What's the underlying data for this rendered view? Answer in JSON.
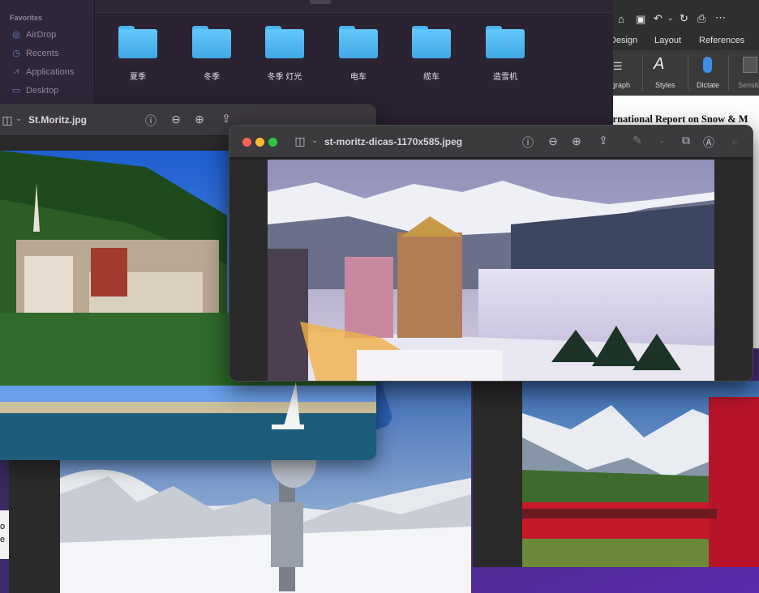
{
  "finder": {
    "favorites_heading": "Favorites",
    "sidebar": [
      {
        "label": "AirDrop",
        "icon": "airdrop-icon"
      },
      {
        "label": "Recents",
        "icon": "clock-icon"
      },
      {
        "label": "Applications",
        "icon": "applications-icon"
      },
      {
        "label": "Desktop",
        "icon": "desktop-icon"
      }
    ],
    "folders": [
      "夏季",
      "冬季",
      "冬季 灯光",
      "电车",
      "缆车",
      "造雪机"
    ]
  },
  "word": {
    "tabs": [
      "Design",
      "Layout",
      "References"
    ],
    "ribbon": [
      "graph",
      "Styles",
      "Dictate",
      "Sensiti"
    ],
    "doc_heading": "ernational Report on Snow & M",
    "peek_lines": [
      "o",
      "e"
    ]
  },
  "preview_back": {
    "title": "St.Moritz.jpg"
  },
  "preview_front": {
    "title": "st-moritz-dicas-1170x585.jpeg"
  },
  "colors": {
    "folder_blue": "#4ab6ef",
    "traffic_red": "#ff5f57",
    "traffic_yellow": "#febc2e",
    "traffic_green": "#28c840"
  }
}
